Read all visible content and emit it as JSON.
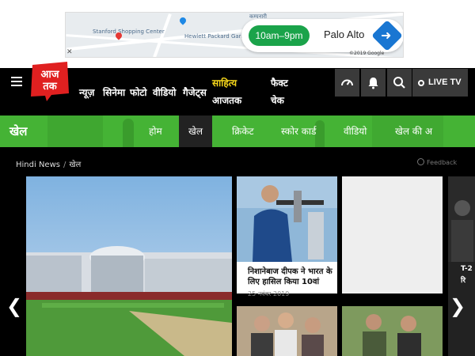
{
  "ad": {
    "hours": "10am–9pm",
    "place": "Palo Alto",
    "close": "✕",
    "map_labels": [
      "Stanford Shopping Center",
      "Hewlett Packard Garage",
      "कम्पनारी"
    ],
    "copyright": "©2019 Google",
    "colors": {
      "hours_bg": "#1aa34a",
      "direction_bg": "#1976d2"
    }
  },
  "header": {
    "logo": {
      "line1": "आज",
      "line2": "तक",
      "color": "#e02020"
    },
    "nav": [
      "न्यूज़",
      "सिनेमा",
      "फोटो",
      "वीडियो",
      "गैजेट्स"
    ],
    "nav_highlight": {
      "line1": "साहित्य",
      "line2": "आजतक"
    },
    "nav_last": {
      "line1": "फैक्ट",
      "line2": "चेक"
    },
    "live": "LIVE TV",
    "icons": [
      "speedometer-icon",
      "bell-icon",
      "search-icon"
    ]
  },
  "sports": {
    "title": "खेल",
    "tabs": [
      {
        "label": "होम",
        "active": false
      },
      {
        "label": "खेल",
        "active": true
      },
      {
        "label": "क्रिकेट",
        "active": false
      },
      {
        "label": "स्कोर कार्ड",
        "active": false
      },
      {
        "label": "वीडियो",
        "active": false
      },
      {
        "label": "खेल की अ",
        "active": false
      }
    ],
    "band_color": "#45b335"
  },
  "breadcrumb": {
    "home": "Hindi News",
    "separator": "/",
    "current": "खेल"
  },
  "feedback": "Feedback",
  "cards": [
    {
      "headline": "निशानेबाज दीपक ने भारत के लिए हासिल किया 10वां",
      "date": "25 नवंबर 2019"
    }
  ],
  "partial_text": [
    "T-2",
    "रि"
  ]
}
